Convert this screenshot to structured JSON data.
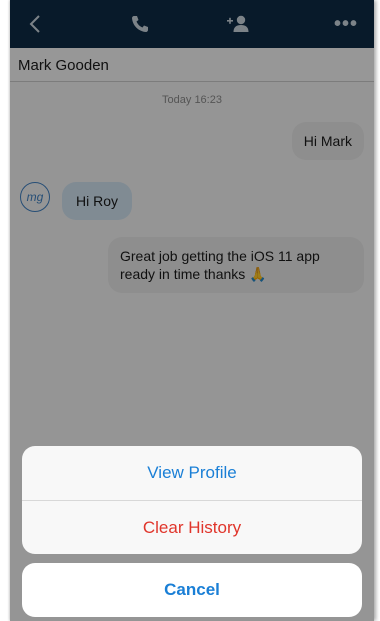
{
  "navbar": {
    "back_icon": "chevron-left-icon",
    "call_icon": "phone-icon",
    "add_contact_icon": "add-person-icon",
    "more_icon": "more-icon",
    "more_glyph": "•••",
    "background": "#0d2b45"
  },
  "contact": {
    "name": "Mark Gooden"
  },
  "chat": {
    "timestamp": "Today 16:23",
    "messages": [
      {
        "direction": "outgoing",
        "text": "Hi Mark"
      },
      {
        "direction": "incoming",
        "text": "Hi Roy",
        "avatar_initials": "mg"
      },
      {
        "direction": "outgoing",
        "text": "Great job getting the iOS 11 app ready in time thanks 🙏"
      }
    ]
  },
  "action_sheet": {
    "view_profile": "View Profile",
    "clear_history": "Clear History",
    "cancel": "Cancel"
  },
  "colors": {
    "action_blue": "#1a7fd6",
    "action_red": "#e0352b",
    "avatar_ring": "#3f7fbf"
  }
}
